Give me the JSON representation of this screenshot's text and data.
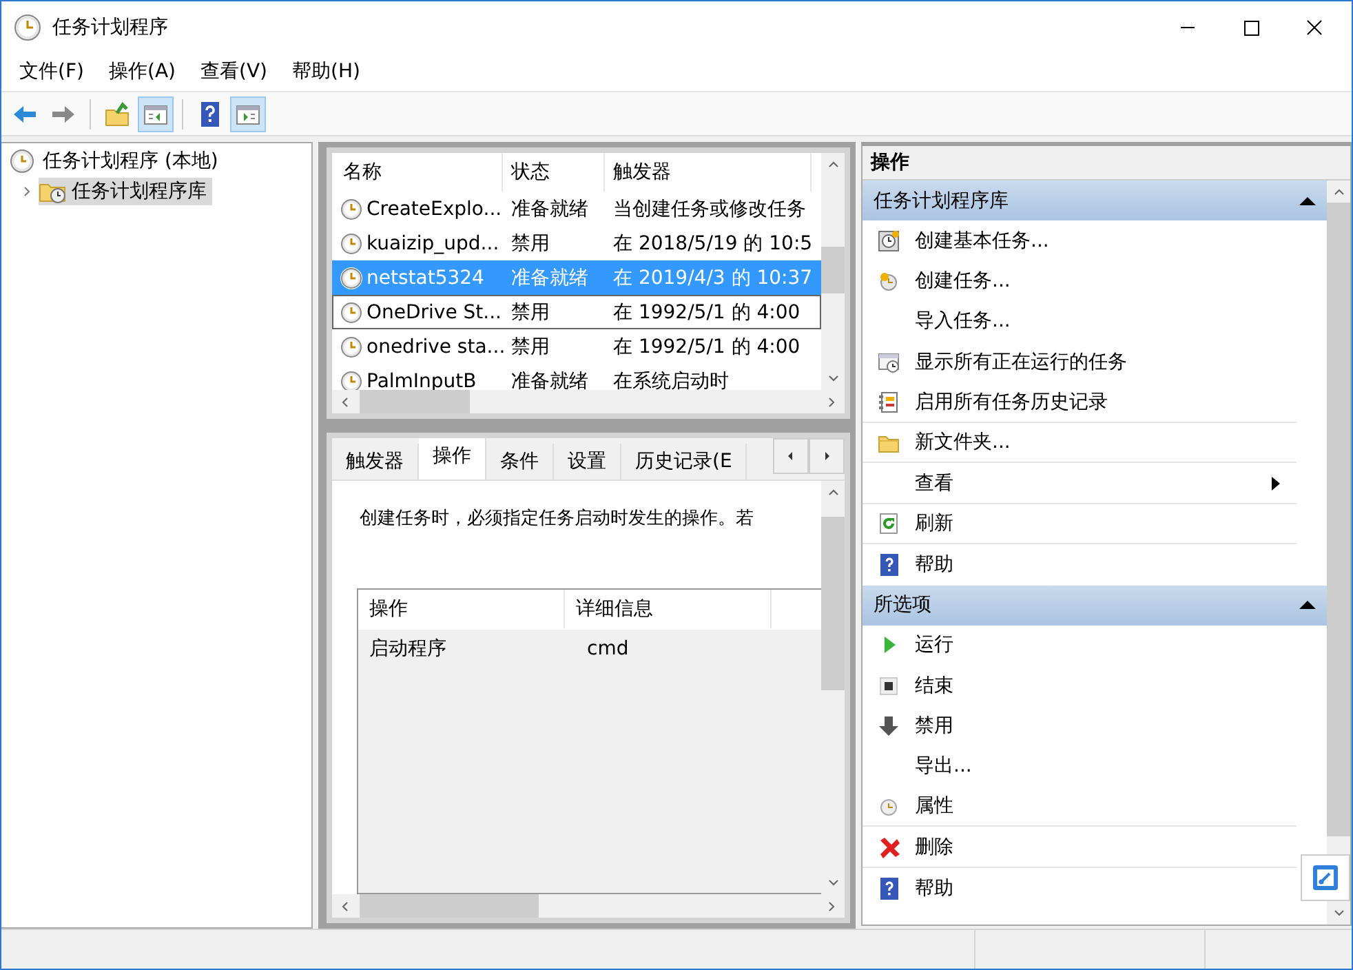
{
  "window": {
    "title": "任务计划程序"
  },
  "menu": [
    "文件(F)",
    "操作(A)",
    "查看(V)",
    "帮助(H)"
  ],
  "toolbar": [
    {
      "kind": "back",
      "pressed": false
    },
    {
      "kind": "forward",
      "pressed": false
    },
    {
      "kind": "sep"
    },
    {
      "kind": "up",
      "pressed": false
    },
    {
      "kind": "tree",
      "pressed": true
    },
    {
      "kind": "sep"
    },
    {
      "kind": "help",
      "pressed": false
    },
    {
      "kind": "pane",
      "pressed": true
    }
  ],
  "tree": [
    {
      "label": "任务计划程序 (本地)",
      "kind": "clock",
      "selected": false,
      "children": [
        {
          "label": "任务计划程序库",
          "kind": "folder",
          "selected": true,
          "expanded": false
        }
      ]
    }
  ],
  "task_list": {
    "columns": [
      "名称",
      "状态",
      "触发器"
    ],
    "rows": [
      {
        "name": "CreateExplo...",
        "status": "准备就绪",
        "trigger": "当创建任务或修改任务",
        "selected": false,
        "focused": false
      },
      {
        "name": "kuaizip_upd...",
        "status": "禁用",
        "trigger": "在 2018/5/19 的 10:5",
        "selected": false,
        "focused": false
      },
      {
        "name": "netstat5324",
        "status": "准备就绪",
        "trigger": "在 2019/4/3 的 10:37",
        "selected": true,
        "focused": false
      },
      {
        "name": "OneDrive St...",
        "status": "禁用",
        "trigger": "在 1992/5/1 的 4:00",
        "selected": false,
        "focused": true
      },
      {
        "name": "onedrive sta...",
        "status": "禁用",
        "trigger": "在 1992/5/1 的 4:00",
        "selected": false,
        "focused": false
      },
      {
        "name": "PalmInputB",
        "status": "准备就绪",
        "trigger": "在系统启动时",
        "selected": false,
        "focused": false
      }
    ]
  },
  "detail_tabs": [
    {
      "label": "触发器",
      "selected": false
    },
    {
      "label": "操作",
      "selected": true
    },
    {
      "label": "条件",
      "selected": false
    },
    {
      "label": "设置",
      "selected": false
    },
    {
      "label": "历史记录(E",
      "selected": false
    }
  ],
  "detail": {
    "description": "创建任务时，必须指定任务启动时发生的操作。若",
    "columns": [
      "操作",
      "详细信息"
    ],
    "rows": [
      {
        "action": "启动程序",
        "details": "cmd"
      }
    ]
  },
  "actions_pane": {
    "title": "操作",
    "sections": [
      {
        "title": "任务计划程序库",
        "expanded": true,
        "items": [
          {
            "label": "创建基本任务...",
            "kind": "basic-task",
            "submenu": false,
            "divider": false
          },
          {
            "label": "创建任务...",
            "kind": "task",
            "submenu": false,
            "divider": false
          },
          {
            "label": "导入任务...",
            "kind": "plain",
            "submenu": false,
            "divider": false
          },
          {
            "label": "显示所有正在运行的任务",
            "kind": "running",
            "submenu": false,
            "divider": false
          },
          {
            "label": "启用所有任务历史记录",
            "kind": "history",
            "submenu": false,
            "divider": true
          },
          {
            "label": "新文件夹...",
            "kind": "folder",
            "submenu": false,
            "divider": true
          },
          {
            "label": "查看",
            "kind": "plain",
            "submenu": true,
            "divider": true
          },
          {
            "label": "刷新",
            "kind": "refresh",
            "submenu": false,
            "divider": true
          },
          {
            "label": "帮助",
            "kind": "help",
            "submenu": false,
            "divider": false
          }
        ]
      },
      {
        "title": "所选项",
        "expanded": true,
        "items": [
          {
            "label": "运行",
            "kind": "run",
            "submenu": false,
            "divider": false
          },
          {
            "label": "结束",
            "kind": "stop",
            "submenu": false,
            "divider": false
          },
          {
            "label": "禁用",
            "kind": "disable",
            "submenu": false,
            "divider": false
          },
          {
            "label": "导出...",
            "kind": "plain",
            "submenu": false,
            "divider": false
          },
          {
            "label": "属性",
            "kind": "properties",
            "submenu": false,
            "divider": true
          },
          {
            "label": "删除",
            "kind": "delete",
            "submenu": false,
            "divider": true
          },
          {
            "label": "帮助",
            "kind": "help",
            "submenu": false,
            "divider": false
          }
        ]
      }
    ]
  }
}
